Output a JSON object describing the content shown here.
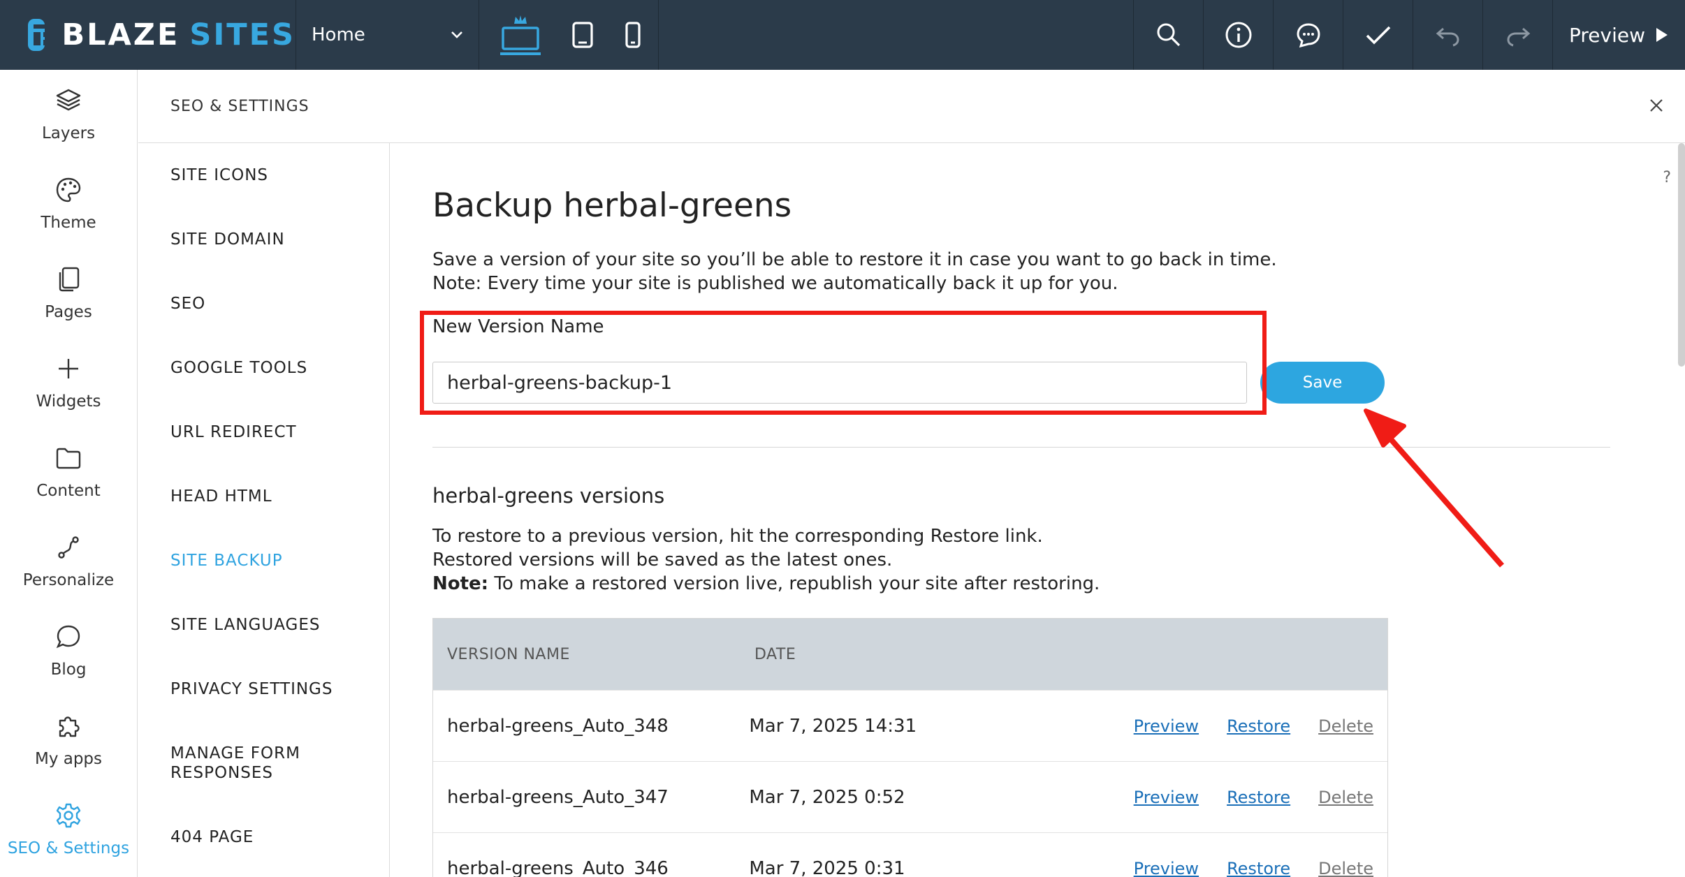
{
  "app": {
    "logo_word1": "BLAZE",
    "logo_word2": "SITES",
    "page_selector": "Home",
    "preview_label": "Preview"
  },
  "rail": {
    "items": [
      {
        "label": "Layers",
        "icon": "layers-icon"
      },
      {
        "label": "Theme",
        "icon": "palette-icon"
      },
      {
        "label": "Pages",
        "icon": "pages-icon"
      },
      {
        "label": "Widgets",
        "icon": "plus-icon"
      },
      {
        "label": "Content",
        "icon": "folder-icon"
      },
      {
        "label": "Personalize",
        "icon": "personalize-icon"
      },
      {
        "label": "Blog",
        "icon": "chat-bubble-icon"
      },
      {
        "label": "My apps",
        "icon": "puzzle-icon"
      },
      {
        "label": "SEO & Settings",
        "icon": "gear-icon",
        "active": true
      }
    ]
  },
  "panel": {
    "title": "SEO & SETTINGS",
    "help": "?"
  },
  "settings_nav": {
    "items": [
      "SITE ICONS",
      "SITE DOMAIN",
      "SEO",
      "GOOGLE TOOLS",
      "URL REDIRECT",
      "HEAD HTML",
      "SITE BACKUP",
      "SITE LANGUAGES",
      "PRIVACY SETTINGS",
      "MANAGE FORM",
      "RESPONSES",
      "404 PAGE"
    ],
    "active": "SITE BACKUP"
  },
  "backup": {
    "title": "Backup herbal-greens",
    "desc_line1": "Save a version of your site so you’ll be able to restore it in case you want to go back in time.",
    "desc_line2": "Note: Every time your site is published we automatically back it up for you.",
    "field_label": "New Version Name",
    "input_value": "herbal-greens-backup-1",
    "save_label": "Save"
  },
  "versions": {
    "heading_name": "herbal-greens",
    "heading_suffix": " versions",
    "restore_line1": "To restore to a previous version, hit the corresponding Restore link.",
    "restore_line2": "Restored versions will be saved as the latest ones.",
    "restore_note_bold": "Note:",
    "restore_note_text": " To make a restored version live, republish your site after restoring.",
    "columns": [
      "VERSION NAME",
      "DATE"
    ],
    "rows": [
      {
        "name": "herbal-greens_Auto_348",
        "date": "Mar 7, 2025 14:31"
      },
      {
        "name": "herbal-greens_Auto_347",
        "date": "Mar 7, 2025 0:52"
      },
      {
        "name": "herbal-greens_Auto_346",
        "date": "Mar 7, 2025 0:31"
      }
    ],
    "actions": {
      "preview": "Preview",
      "restore": "Restore",
      "delete": "Delete"
    }
  },
  "colors": {
    "topbar": "#2b3b4a",
    "accent": "#2fa3e0",
    "highlight": "#f01c16"
  }
}
